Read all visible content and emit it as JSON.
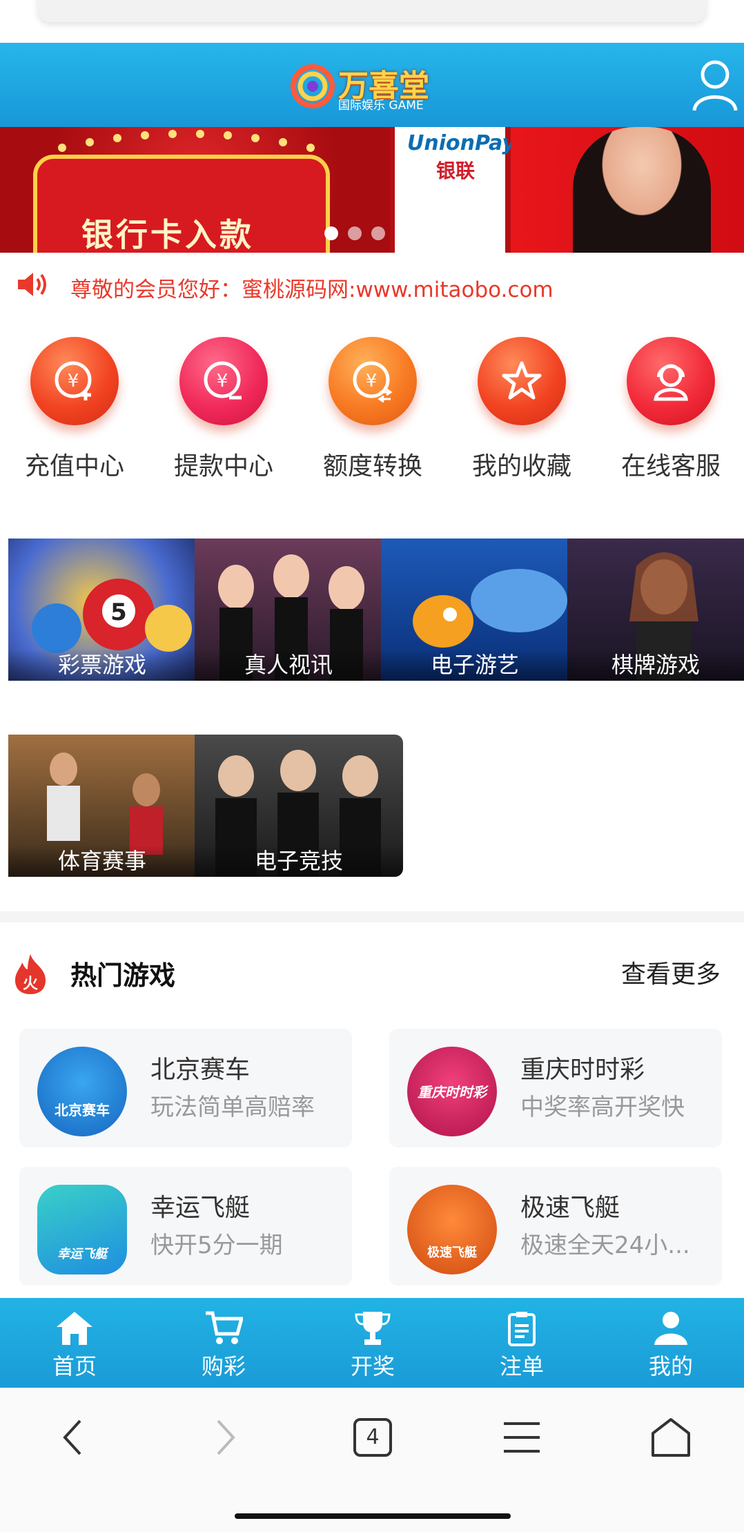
{
  "header": {
    "logo_title": "万喜堂",
    "logo_subtitle": "国际娱乐 GAME",
    "user_icon": "user-icon"
  },
  "banner": {
    "main_text": "银行卡入款",
    "card_brand": "UnionPay",
    "card_brand_cn": "银联",
    "slides": 4,
    "active_slide": 1
  },
  "notice": {
    "icon": "speaker-icon",
    "text": "尊敬的会员您好：蜜桃源码网:www.mitaobo.com"
  },
  "quick_actions": [
    {
      "label": "充值中心",
      "icon": "deposit-icon"
    },
    {
      "label": "提款中心",
      "icon": "withdraw-icon"
    },
    {
      "label": "额度转换",
      "icon": "transfer-icon"
    },
    {
      "label": "我的收藏",
      "icon": "star-icon"
    },
    {
      "label": "在线客服",
      "icon": "support-icon"
    }
  ],
  "categories": [
    {
      "label": "彩票游戏"
    },
    {
      "label": "真人视讯"
    },
    {
      "label": "电子游艺"
    },
    {
      "label": "棋牌游戏"
    },
    {
      "label": "体育赛事"
    },
    {
      "label": "电子竞技"
    }
  ],
  "hot_games": {
    "title": "热门游戏",
    "more": "查看更多",
    "items": [
      {
        "name": "北京赛车",
        "desc": "玩法简单高赔率",
        "icon_text": "北京赛车"
      },
      {
        "name": "重庆时时彩",
        "desc": "中奖率高开奖快",
        "icon_text": "重庆时时彩"
      },
      {
        "name": "幸运飞艇",
        "desc": "快开5分一期",
        "icon_text": "幸运飞艇"
      },
      {
        "name": "极速飞艇",
        "desc": "极速全天24小...",
        "icon_text": "极速飞艇"
      }
    ]
  },
  "tabbar": [
    {
      "label": "首页",
      "icon": "home-icon"
    },
    {
      "label": "购彩",
      "icon": "cart-icon"
    },
    {
      "label": "开奖",
      "icon": "trophy-icon"
    },
    {
      "label": "注单",
      "icon": "clipboard-icon"
    },
    {
      "label": "我的",
      "icon": "person-icon"
    }
  ],
  "browser_nav": {
    "tab_count": "4"
  }
}
